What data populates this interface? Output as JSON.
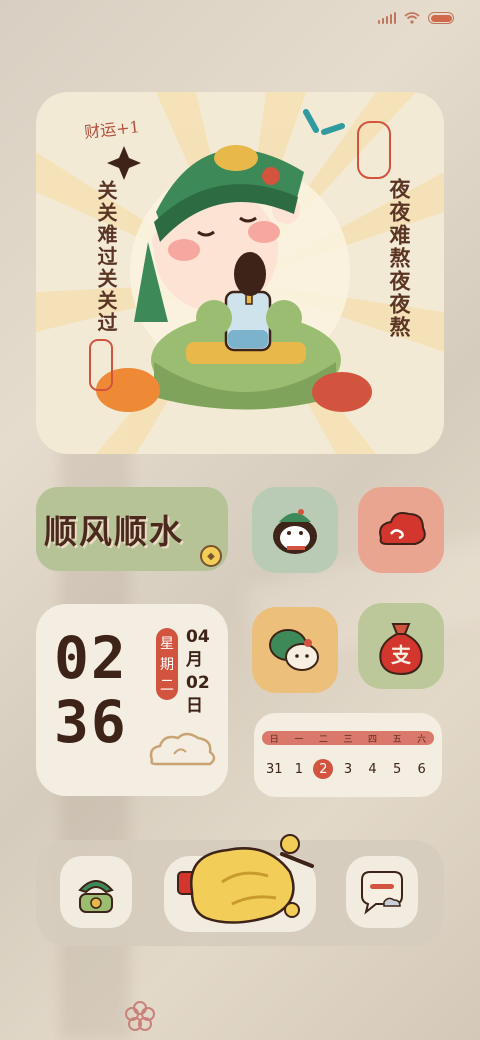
{
  "hero": {
    "caption_top": "财运+1",
    "left_vertical": "关关难过关关过",
    "right_vertical": "夜夜难熬夜夜熬"
  },
  "shunfeng": {
    "text": "顺风顺水",
    "coin_symbol": "◆"
  },
  "clock": {
    "hours": "02",
    "minutes": "36",
    "weekday_chars": [
      "星",
      "期",
      "二"
    ],
    "month": "04",
    "month_unit": "月",
    "day": "02",
    "day_unit": "日"
  },
  "calendar": {
    "weekdays": [
      "日",
      "一",
      "二",
      "三",
      "四",
      "五",
      "六"
    ],
    "days": [
      "31",
      "1",
      "2",
      "3",
      "4",
      "5",
      "6"
    ],
    "today": "2"
  },
  "colors": {
    "accent_red": "#d2543f",
    "shun_green": "#b5c397",
    "status_orange": "#c0765a"
  },
  "icons": {
    "status": [
      "signal-icon",
      "wifi-icon",
      "battery-icon"
    ],
    "grid": [
      "penguin-app-icon",
      "red-cloud-app-icon",
      "chat-bubbles-app-icon",
      "payment-bag-app-icon"
    ],
    "dock": [
      "phone-app-icon",
      "golden-chicken-app-icon",
      "message-app-icon"
    ]
  }
}
